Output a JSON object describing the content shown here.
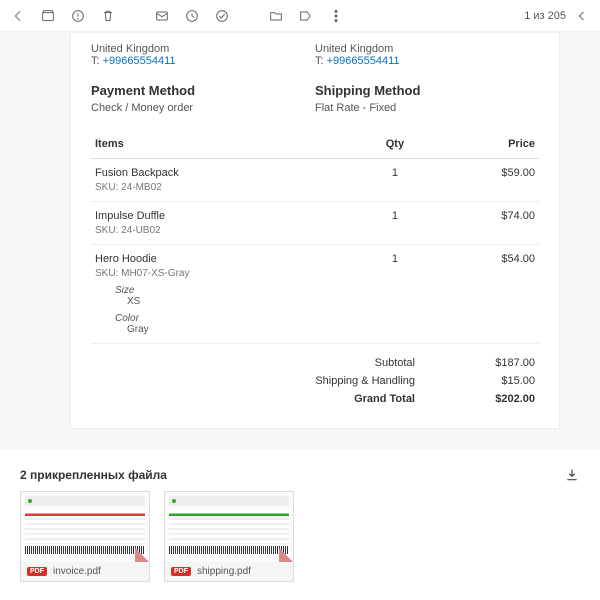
{
  "toolbar": {
    "counter": "1 из 205"
  },
  "address": {
    "left": {
      "country": "United Kingdom",
      "tel_prefix": "T: ",
      "tel": "+99665554411"
    },
    "right": {
      "country": "United Kingdom",
      "tel_prefix": "T: ",
      "tel": "+99665554411"
    }
  },
  "payment": {
    "heading": "Payment Method",
    "value": "Check / Money order"
  },
  "shipping": {
    "heading": "Shipping Method",
    "value": "Flat Rate - Fixed"
  },
  "table": {
    "headers": {
      "items": "Items",
      "qty": "Qty",
      "price": "Price"
    },
    "rows": [
      {
        "name": "Fusion Backpack",
        "sku_label": "SKU: 24-MB02",
        "qty": "1",
        "price": "$59.00",
        "opts": []
      },
      {
        "name": "Impulse Duffle",
        "sku_label": "SKU: 24-UB02",
        "qty": "1",
        "price": "$74.00",
        "opts": []
      },
      {
        "name": "Hero Hoodie",
        "sku_label": "SKU: MH07-XS-Gray",
        "qty": "1",
        "price": "$54.00",
        "opts": [
          {
            "k": "Size",
            "v": "XS"
          },
          {
            "k": "Color",
            "v": "Gray"
          }
        ]
      }
    ]
  },
  "totals": {
    "subtotal": {
      "label": "Subtotal",
      "value": "$187.00"
    },
    "shipping": {
      "label": "Shipping & Handling",
      "value": "$15.00"
    },
    "grand": {
      "label": "Grand Total",
      "value": "$202.00"
    }
  },
  "attachments": {
    "heading": "2 прикрепленных файла",
    "files": [
      {
        "name": "invoice.pdf",
        "badge": "PDF"
      },
      {
        "name": "shipping.pdf",
        "badge": "PDF"
      }
    ]
  }
}
